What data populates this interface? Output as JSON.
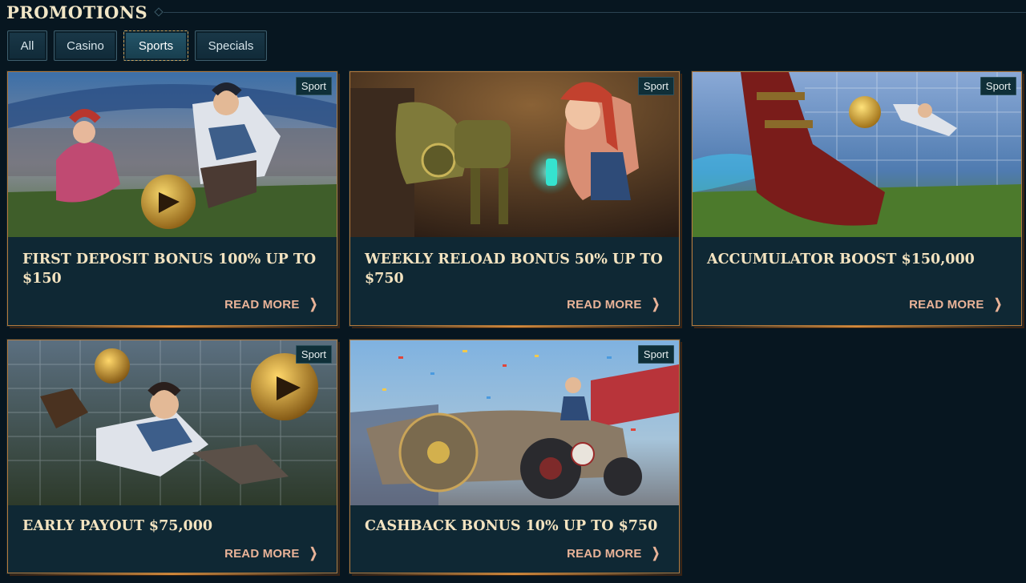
{
  "page": {
    "title": "PROMOTIONS"
  },
  "filters": [
    {
      "label": "All",
      "active": false
    },
    {
      "label": "Casino",
      "active": false
    },
    {
      "label": "Sports",
      "active": true
    },
    {
      "label": "Specials",
      "active": false
    }
  ],
  "cards": [
    {
      "badge": "Sport",
      "title": "FIRST DEPOSIT BONUS 100% UP TO $150",
      "cta": "READ MORE",
      "image": "stadium-football-heroes"
    },
    {
      "badge": "Sport",
      "title": "WEEKLY RELOAD BONUS 50% UP TO $750",
      "cta": "READ MORE",
      "image": "robot-dog-workshop"
    },
    {
      "badge": "Sport",
      "title": "ACCUMULATOR BOOST $150,000",
      "cta": "READ MORE",
      "image": "boot-kick-goal"
    },
    {
      "badge": "Sport",
      "title": "EARLY PAYOUT $75,000",
      "cta": "READ MORE",
      "image": "goalkeeper-dive"
    },
    {
      "badge": "Sport",
      "title": "CASHBACK BONUS 10% UP TO $750",
      "cta": "READ MORE",
      "image": "race-car-finish"
    }
  ],
  "icons": {
    "read_more": "chevron-right-icon",
    "header_ornament": "diamond-icon"
  },
  "colors": {
    "background": "#071620",
    "card": "#0f2834",
    "card_border": "#b47a3c",
    "title": "#f3e3c0",
    "cta": "#e9b398",
    "active_filter_border": "#c9a462"
  }
}
